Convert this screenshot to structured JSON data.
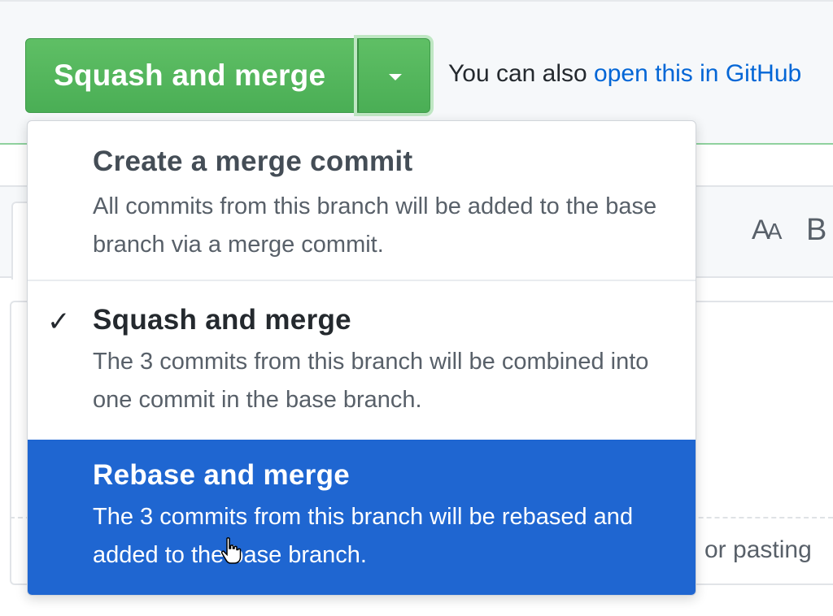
{
  "merge_box": {
    "primary_button_label": "Squash and merge",
    "also_text": "You can also",
    "also_link": "open this in GitHub"
  },
  "editor": {
    "text_size_icon_big": "A",
    "text_size_icon_small": "A",
    "bold_icon": "B",
    "paste_hint": "or pasting"
  },
  "merge_menu": {
    "items": [
      {
        "title": "Create a merge commit",
        "description": "All commits from this branch will be added to the base branch via a merge commit.",
        "selected": false,
        "highlighted": false
      },
      {
        "title": "Squash and merge",
        "description": "The 3 commits from this branch will be combined into one commit in the base branch.",
        "selected": true,
        "highlighted": false
      },
      {
        "title": "Rebase and merge",
        "description": "The 3 commits from this branch will be rebased and added to the base branch.",
        "selected": false,
        "highlighted": true
      }
    ],
    "check_glyph": "✓"
  },
  "colors": {
    "merge_green": "#4aae55",
    "highlight_blue": "#1f66d1",
    "link_blue": "#0366d6"
  }
}
